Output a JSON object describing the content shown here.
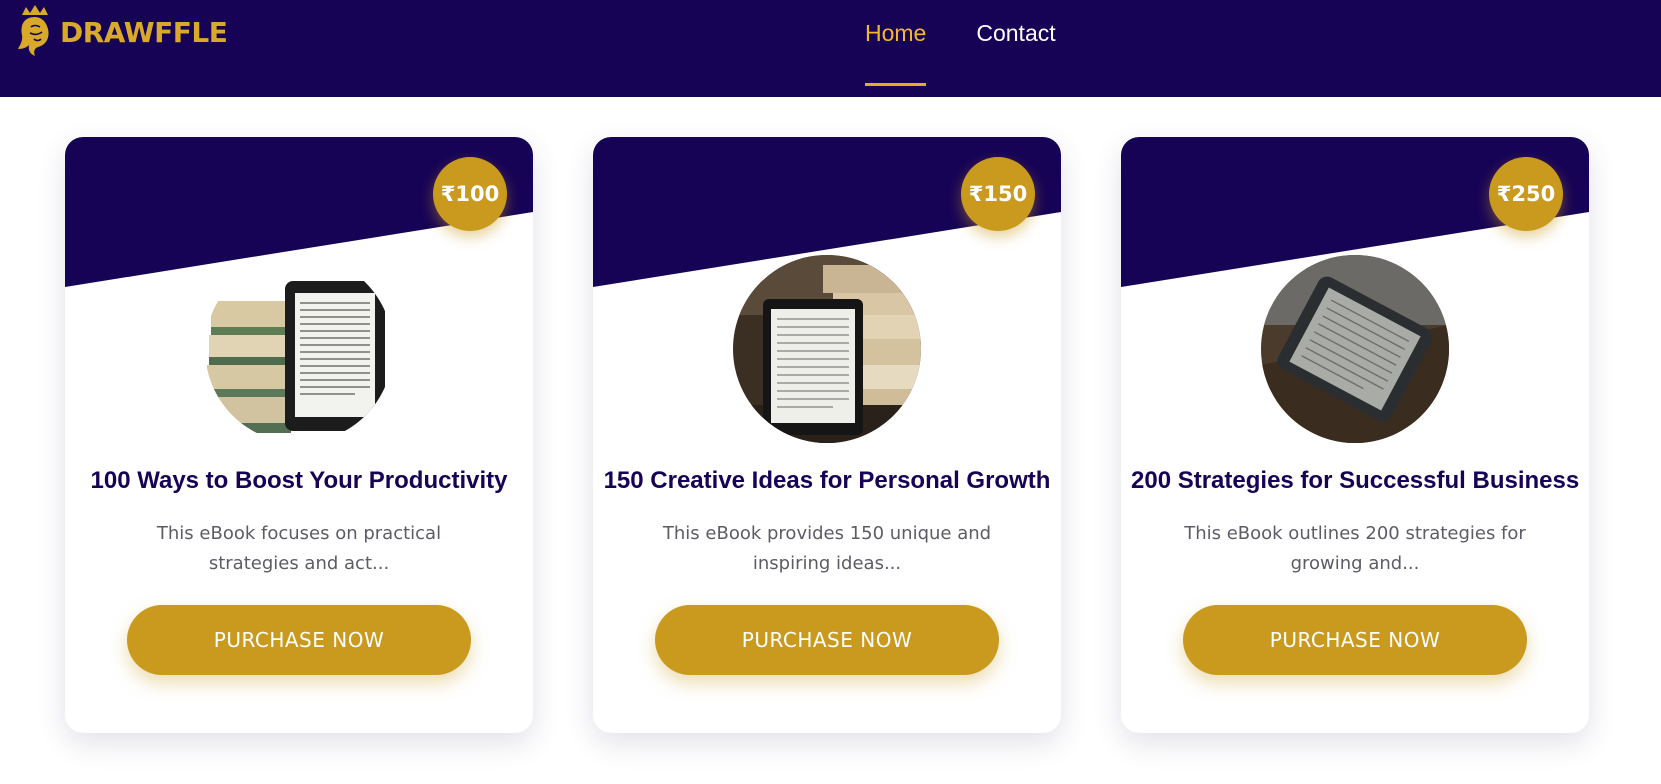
{
  "brand": {
    "name": "DRAWFFLE",
    "colors": {
      "navy": "#160356",
      "gold": "#c99a1d",
      "nav_active": "#f3b72c"
    }
  },
  "nav": {
    "items": [
      {
        "label": "Home",
        "active": true
      },
      {
        "label": "Contact",
        "active": false
      }
    ]
  },
  "products": [
    {
      "price": "₹100",
      "title": "100 Ways to Boost Your Productivity",
      "description": "This eBook focuses on practical strategies and act...",
      "button_label": "PURCHASE NOW",
      "image_icon": "ereader-with-books-icon"
    },
    {
      "price": "₹150",
      "title": "150 Creative Ideas for Personal Growth",
      "description": "This eBook provides 150 unique and inspiring ideas...",
      "button_label": "PURCHASE NOW",
      "image_icon": "tablet-on-book-stack-icon"
    },
    {
      "price": "₹250",
      "title": "200 Strategies for Successful Business",
      "description": "This eBook outlines 200 strategies for growing and...",
      "button_label": "PURCHASE NOW",
      "image_icon": "ereader-on-table-icon"
    }
  ]
}
